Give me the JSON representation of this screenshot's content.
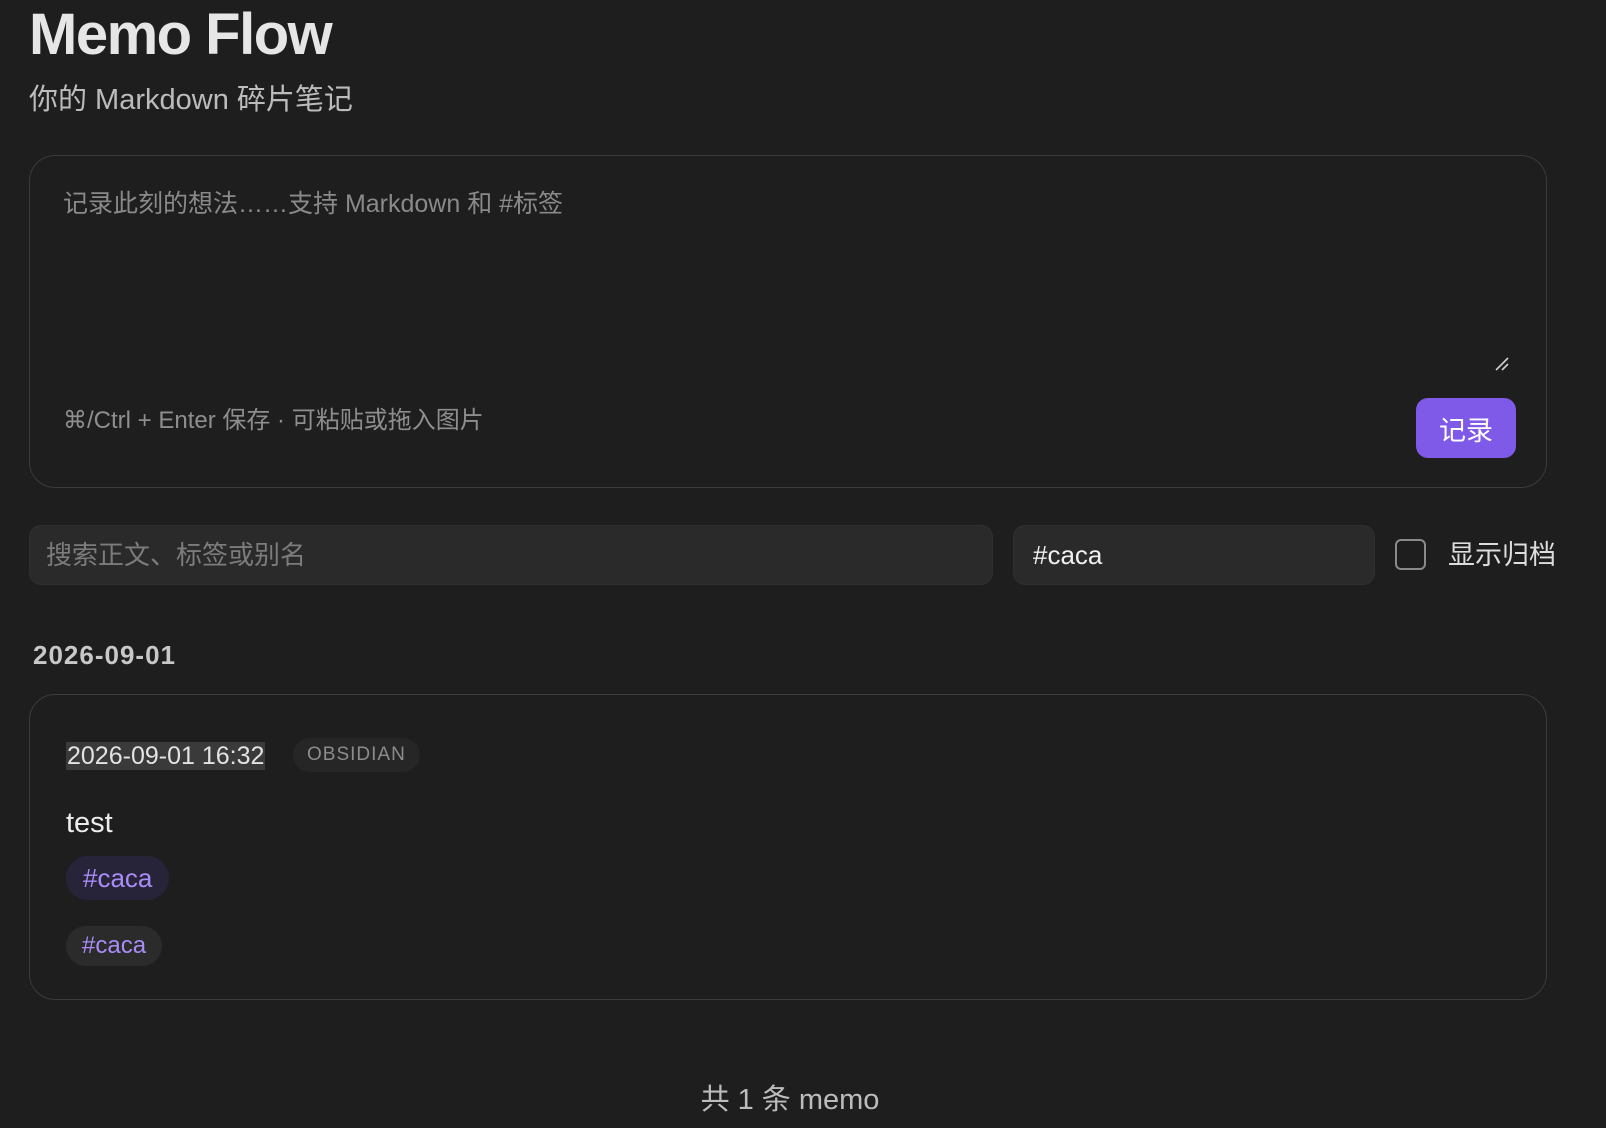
{
  "app": {
    "title": "Memo Flow",
    "subtitle": "你的 Markdown 碎片笔记"
  },
  "composer": {
    "placeholder": "记录此刻的想法……支持 Markdown 和 #标签",
    "value": "",
    "hint": "⌘/Ctrl + Enter 保存 · 可粘贴或拖入图片",
    "save_label": "记录"
  },
  "filters": {
    "search_placeholder": "搜索正文、标签或别名",
    "search_value": "",
    "tag_value": "#caca",
    "show_archived_label": "显示归档",
    "show_archived_checked": false
  },
  "groups": [
    {
      "date": "2026-09-01",
      "memos": [
        {
          "timestamp": "2026-09-01 16:32",
          "source": "OBSIDIAN",
          "body": "test",
          "inline_tag": "#caca",
          "tags": [
            "#caca"
          ]
        }
      ]
    }
  ],
  "footer": {
    "count_text": "共 1 条 memo"
  },
  "colors": {
    "background": "#1e1e1e",
    "accent": "#7f5ae8",
    "tag_text": "#a98cf7"
  }
}
